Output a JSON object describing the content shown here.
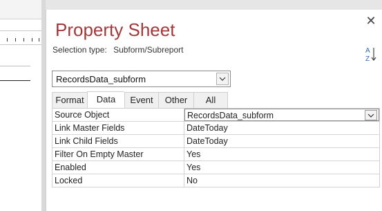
{
  "pane": {
    "title": "Property Sheet",
    "selection_type_label": "Selection type:",
    "selection_type_value": "Subform/Subreport",
    "close_glyph": "✕",
    "sort_icon": "sort-az-icon"
  },
  "object_combo": {
    "value": "RecordsData_subform"
  },
  "tabs": [
    {
      "label": "Format"
    },
    {
      "label": "Data"
    },
    {
      "label": "Event"
    },
    {
      "label": "Other"
    },
    {
      "label": "All"
    }
  ],
  "active_tab": "Data",
  "properties": [
    {
      "name": "Source Object",
      "value": "RecordsData_subform"
    },
    {
      "name": "Link Master Fields",
      "value": "DateToday"
    },
    {
      "name": "Link Child Fields",
      "value": "DateToday"
    },
    {
      "name": "Filter On Empty Master",
      "value": "Yes"
    },
    {
      "name": "Enabled",
      "value": "Yes"
    },
    {
      "name": "Locked",
      "value": "No"
    }
  ],
  "colors": {
    "title": "#a4373a",
    "sort_icon_blue": "#2b6cb0"
  }
}
